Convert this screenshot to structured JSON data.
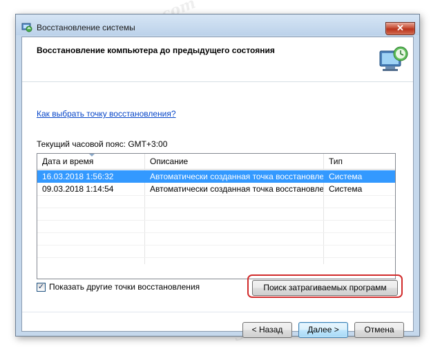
{
  "window": {
    "title": "Восстановление системы",
    "close_label": "✕"
  },
  "header": {
    "title": "Восстановление компьютера до предыдущего состояния"
  },
  "link_text": "Как выбрать точку восстановления?",
  "timezone_text": "Текущий часовой пояс: GMT+3:00",
  "table": {
    "columns": [
      "Дата и время",
      "Описание",
      "Тип"
    ],
    "rows": [
      {
        "date": "16.03.2018 1:56:32",
        "description": "Автоматически созданная точка восстановле...",
        "type": "Система",
        "selected": true
      },
      {
        "date": "09.03.2018 1:14:54",
        "description": "Автоматически созданная точка восстановле...",
        "type": "Система",
        "selected": false
      }
    ]
  },
  "checkbox": {
    "label": "Показать другие точки восстановления",
    "checked": true,
    "mark": "✓"
  },
  "buttons": {
    "scan": "Поиск затрагиваемых программ",
    "back": "< Назад",
    "next": "Далее >",
    "cancel": "Отмена"
  },
  "watermark": "Soringpcrepair.com",
  "colors": {
    "selection": "#3399ff",
    "link": "#0645c8",
    "highlight": "#d12b2b"
  }
}
